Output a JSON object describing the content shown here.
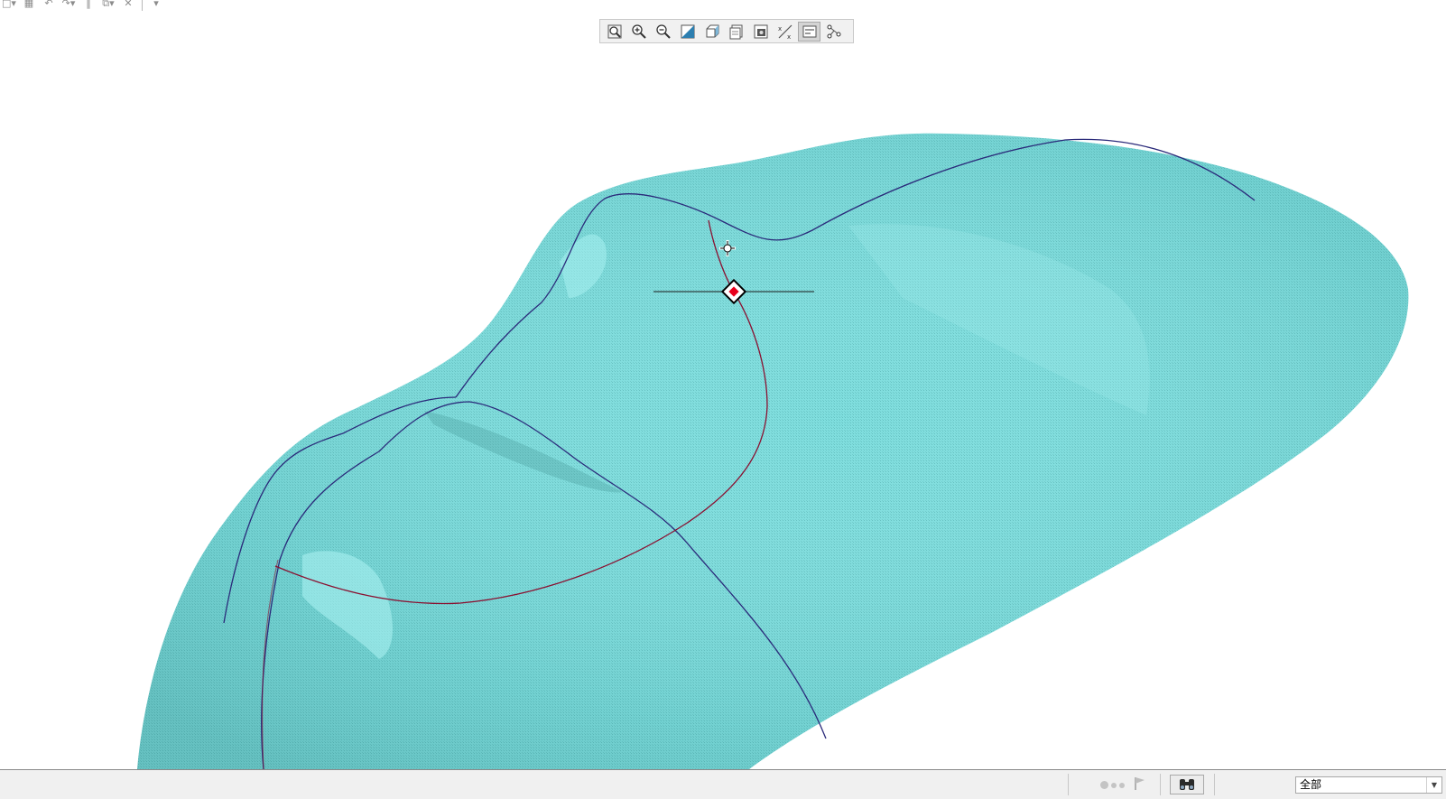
{
  "quick_toolbar": {
    "items": [
      {
        "icon": "new-file-icon"
      },
      {
        "icon": "save-icon"
      },
      {
        "icon": "undo-icon"
      },
      {
        "icon": "redo-icon"
      },
      {
        "icon": "regenerate-icon"
      },
      {
        "icon": "windows-icon"
      },
      {
        "icon": "close-icon"
      },
      {
        "icon": "customize-dropdown-icon"
      }
    ]
  },
  "view_toolbar": {
    "buttons": [
      {
        "name": "refit",
        "icon": "zoom-fit-icon",
        "active": false
      },
      {
        "name": "zoom-in",
        "icon": "zoom-in-icon",
        "active": false
      },
      {
        "name": "zoom-out",
        "icon": "zoom-out-icon",
        "active": false
      },
      {
        "name": "repaint",
        "icon": "repaint-icon",
        "active": false
      },
      {
        "name": "reorient",
        "icon": "reorient-icon",
        "active": false
      },
      {
        "name": "saved-orientations",
        "icon": "saved-views-icon",
        "active": false
      },
      {
        "name": "display-style",
        "icon": "display-style-icon",
        "active": false
      },
      {
        "name": "datum-display",
        "icon": "datum-display-icon",
        "active": false
      },
      {
        "name": "annotation-display",
        "icon": "annotation-display-icon",
        "active": true
      },
      {
        "name": "spin-center",
        "icon": "spin-center-icon",
        "active": false
      }
    ]
  },
  "viewport": {
    "surface_color": "#76d6d6",
    "surface_dark": "#5fb9b9",
    "curve_blue": "#2a2a7a",
    "curve_red": "#8a1030",
    "handle_fill": "#e8001c"
  },
  "statusbar": {
    "filter_value": "全部",
    "find_icon": "binoculars-icon",
    "flag_icon": "flag-icon"
  }
}
